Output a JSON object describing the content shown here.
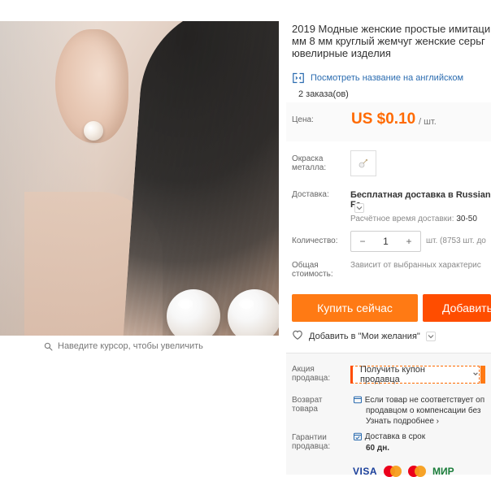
{
  "product": {
    "title": "2019 Модные женские простые имитаци мм 8 мм круглый жемчуг женские серьг ювелирные изделия",
    "translate_link": "Посмотреть название на английском",
    "orders": "2 заказа(ов)"
  },
  "image": {
    "zoom_hint": "Наведите курсор, чтобы увеличить"
  },
  "price": {
    "label": "Цена:",
    "value": "US $0.10",
    "unit": "/ шт."
  },
  "metal_color": {
    "label": "Окраска металла:"
  },
  "shipping": {
    "label": "Доставка:",
    "value_prefix": "Бесплатная доставка в",
    "value_destination": "Russian Fe",
    "est_label": "Расчётное время доставки:",
    "est_value": "30-50"
  },
  "quantity": {
    "label": "Количество:",
    "minus": "−",
    "value": "1",
    "plus": "+",
    "stock": "шт. (8753 шт. до"
  },
  "total": {
    "label": "Общая стоимость:",
    "value": "Зависит от выбранных характерис"
  },
  "actions": {
    "buy_now": "Купить сейчас",
    "add": "Добавить"
  },
  "wishlist": {
    "label": "Добавить в \"Мои желания\""
  },
  "promo": {
    "label": "Акция продавца:",
    "coupon_label": "Получить купон продавца"
  },
  "returns": {
    "label": "Возврат товара",
    "text_line1": "Если товар не соответствует оп",
    "text_line2": "продавцом о компенсации без",
    "link": "Узнать подробнее ›"
  },
  "guarantee": {
    "label": "Гарантии продавца:",
    "text_line1": "Доставка в срок",
    "text_line2": "60 дн."
  },
  "payment": {
    "visa": "VISA",
    "mir": "МИР"
  },
  "colors": {
    "accent_orange": "#ff7a14",
    "accent_red_orange": "#ff4d00",
    "link_blue": "#2b6cb0"
  }
}
